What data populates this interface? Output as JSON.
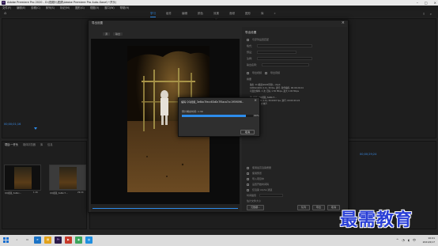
{
  "window": {
    "title": "Adobe Premiere Pro 2020 - D:\\视频\\\\\\视频\\Adobe Premiere Pro Auto-Save\\一开头\\"
  },
  "menu": [
    "文件(F)",
    "编辑(E)",
    "剪辑(C)",
    "序列(S)",
    "标记(M)",
    "图形(G)",
    "视图(V)",
    "窗口(W)",
    "帮助(H)"
  ],
  "workspace_tabs": [
    "学习",
    "组件",
    "编辑",
    "颜色",
    "效果",
    "音频",
    "图形",
    "库",
    "»"
  ],
  "source": {
    "timecode": "00;00;01;16"
  },
  "program": {
    "timecode": "00;00;29;24"
  },
  "project": {
    "tabs": [
      "项目:一开头",
      "媒体浏览器",
      "库",
      "信息"
    ],
    "items": [
      {
        "label": "QQ视频_3e6bc…",
        "duration": "1:16"
      },
      {
        "label": "QQ视频_3e6bc7…",
        "duration": "29:24"
      }
    ]
  },
  "export_dialog": {
    "title": "导出设置",
    "source_tabs": [
      "源",
      "输出"
    ],
    "settings_header": "导出设置",
    "rows": [
      "与序列设置匹配",
      "格式：",
      "预设：",
      "注释：",
      "输出名称：",
      "导出视频",
      "导出音频"
    ],
    "summary_title": "摘要",
    "summary_lines": [
      "输出: D:\\视频\\2020剪辑\\...\\mp4",
      "1080x1920 (1.0), 30 fps, 逐行, 软件编码, 00:00:29:24",
      "可变比特率, 1 次, 目标 1.50 Mbps, 最大 2.00 Mbps",
      "源: 剪辑, QQ视频_3e6bc7…",
      "1080x1920 (1.0), 30.0003 fps, 逐行, 00:00:29:24",
      "44100 Hz, 立体声"
    ],
    "lower_rows": [
      "使用最高渲染质量",
      "使用预览",
      "导入项目中",
      "设置开始时间码",
      "仅渲染 Alpha 通道",
      "时间插值",
      "估计文件大小"
    ],
    "buttons": {
      "metadata": "元数据...",
      "queue": "队列",
      "export": "导出",
      "cancel": "取消"
    }
  },
  "encode_modal": {
    "title": "编码 QQ视频_3e6bc7fecc63d0c7f5aca7cc1959096..",
    "remaining": "预计剩余时间: 1:39",
    "progress_percent": 90,
    "progress_label": "90%",
    "cancel_label": "取消"
  },
  "watermark": {
    "text": "最需教育"
  },
  "taskbar": {
    "time": "10:01",
    "date": "2021/6/17"
  },
  "colors": {
    "accent": "#2d8ceb",
    "watermark": "#2a3fd6"
  }
}
